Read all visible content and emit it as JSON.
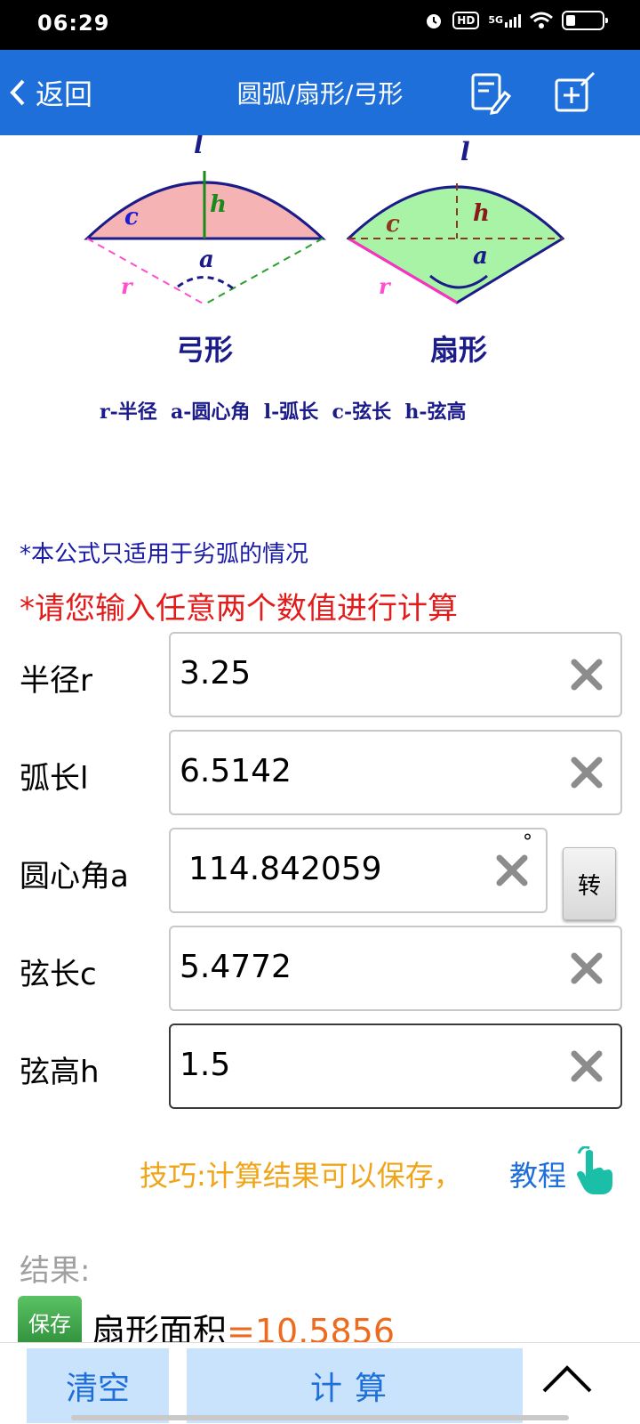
{
  "status_bar": {
    "time": "06:29",
    "hd": "HD",
    "net": "5G"
  },
  "navbar": {
    "back_label": "返回",
    "title": "圆弧/扇形/弓形"
  },
  "diagram": {
    "left_title": "弓形",
    "right_title": "扇形",
    "legend": "r-半径  a-圆心角  l-弧长  c-弦长  h-弦高",
    "l": "l",
    "c": "c",
    "h": "h",
    "a": "a",
    "r": "r"
  },
  "notes": {
    "note1": "*本公式只适用于劣弧的情况",
    "note2": "*请您输入任意两个数值进行计算"
  },
  "form": {
    "radius": {
      "label": "半径r",
      "value": "3.25"
    },
    "arc": {
      "label": "弧长l",
      "value": "6.5142"
    },
    "angle": {
      "label": "圆心角a",
      "value": "114.842059",
      "unit": "°",
      "convert": "转"
    },
    "chord": {
      "label": "弦长c",
      "value": "5.4772"
    },
    "height": {
      "label": "弦高h",
      "value": "1.5"
    }
  },
  "tip": {
    "text": "技巧:计算结果可以保存，",
    "link": "教程"
  },
  "result": {
    "title": "结果:",
    "save": "保存",
    "label": "扇形面积",
    "value": "=10.5856"
  },
  "bottom": {
    "clear": "清空",
    "calc": "计算"
  },
  "colors": {
    "nav": "#1e6fd9",
    "segment_fill": "#f6b3b3",
    "sector_fill": "#a9f3a6",
    "warning": "#e21b1b",
    "tip": "#f0a418",
    "result_value": "#ee6a1c",
    "bottom_button": "#c8e3fb"
  }
}
